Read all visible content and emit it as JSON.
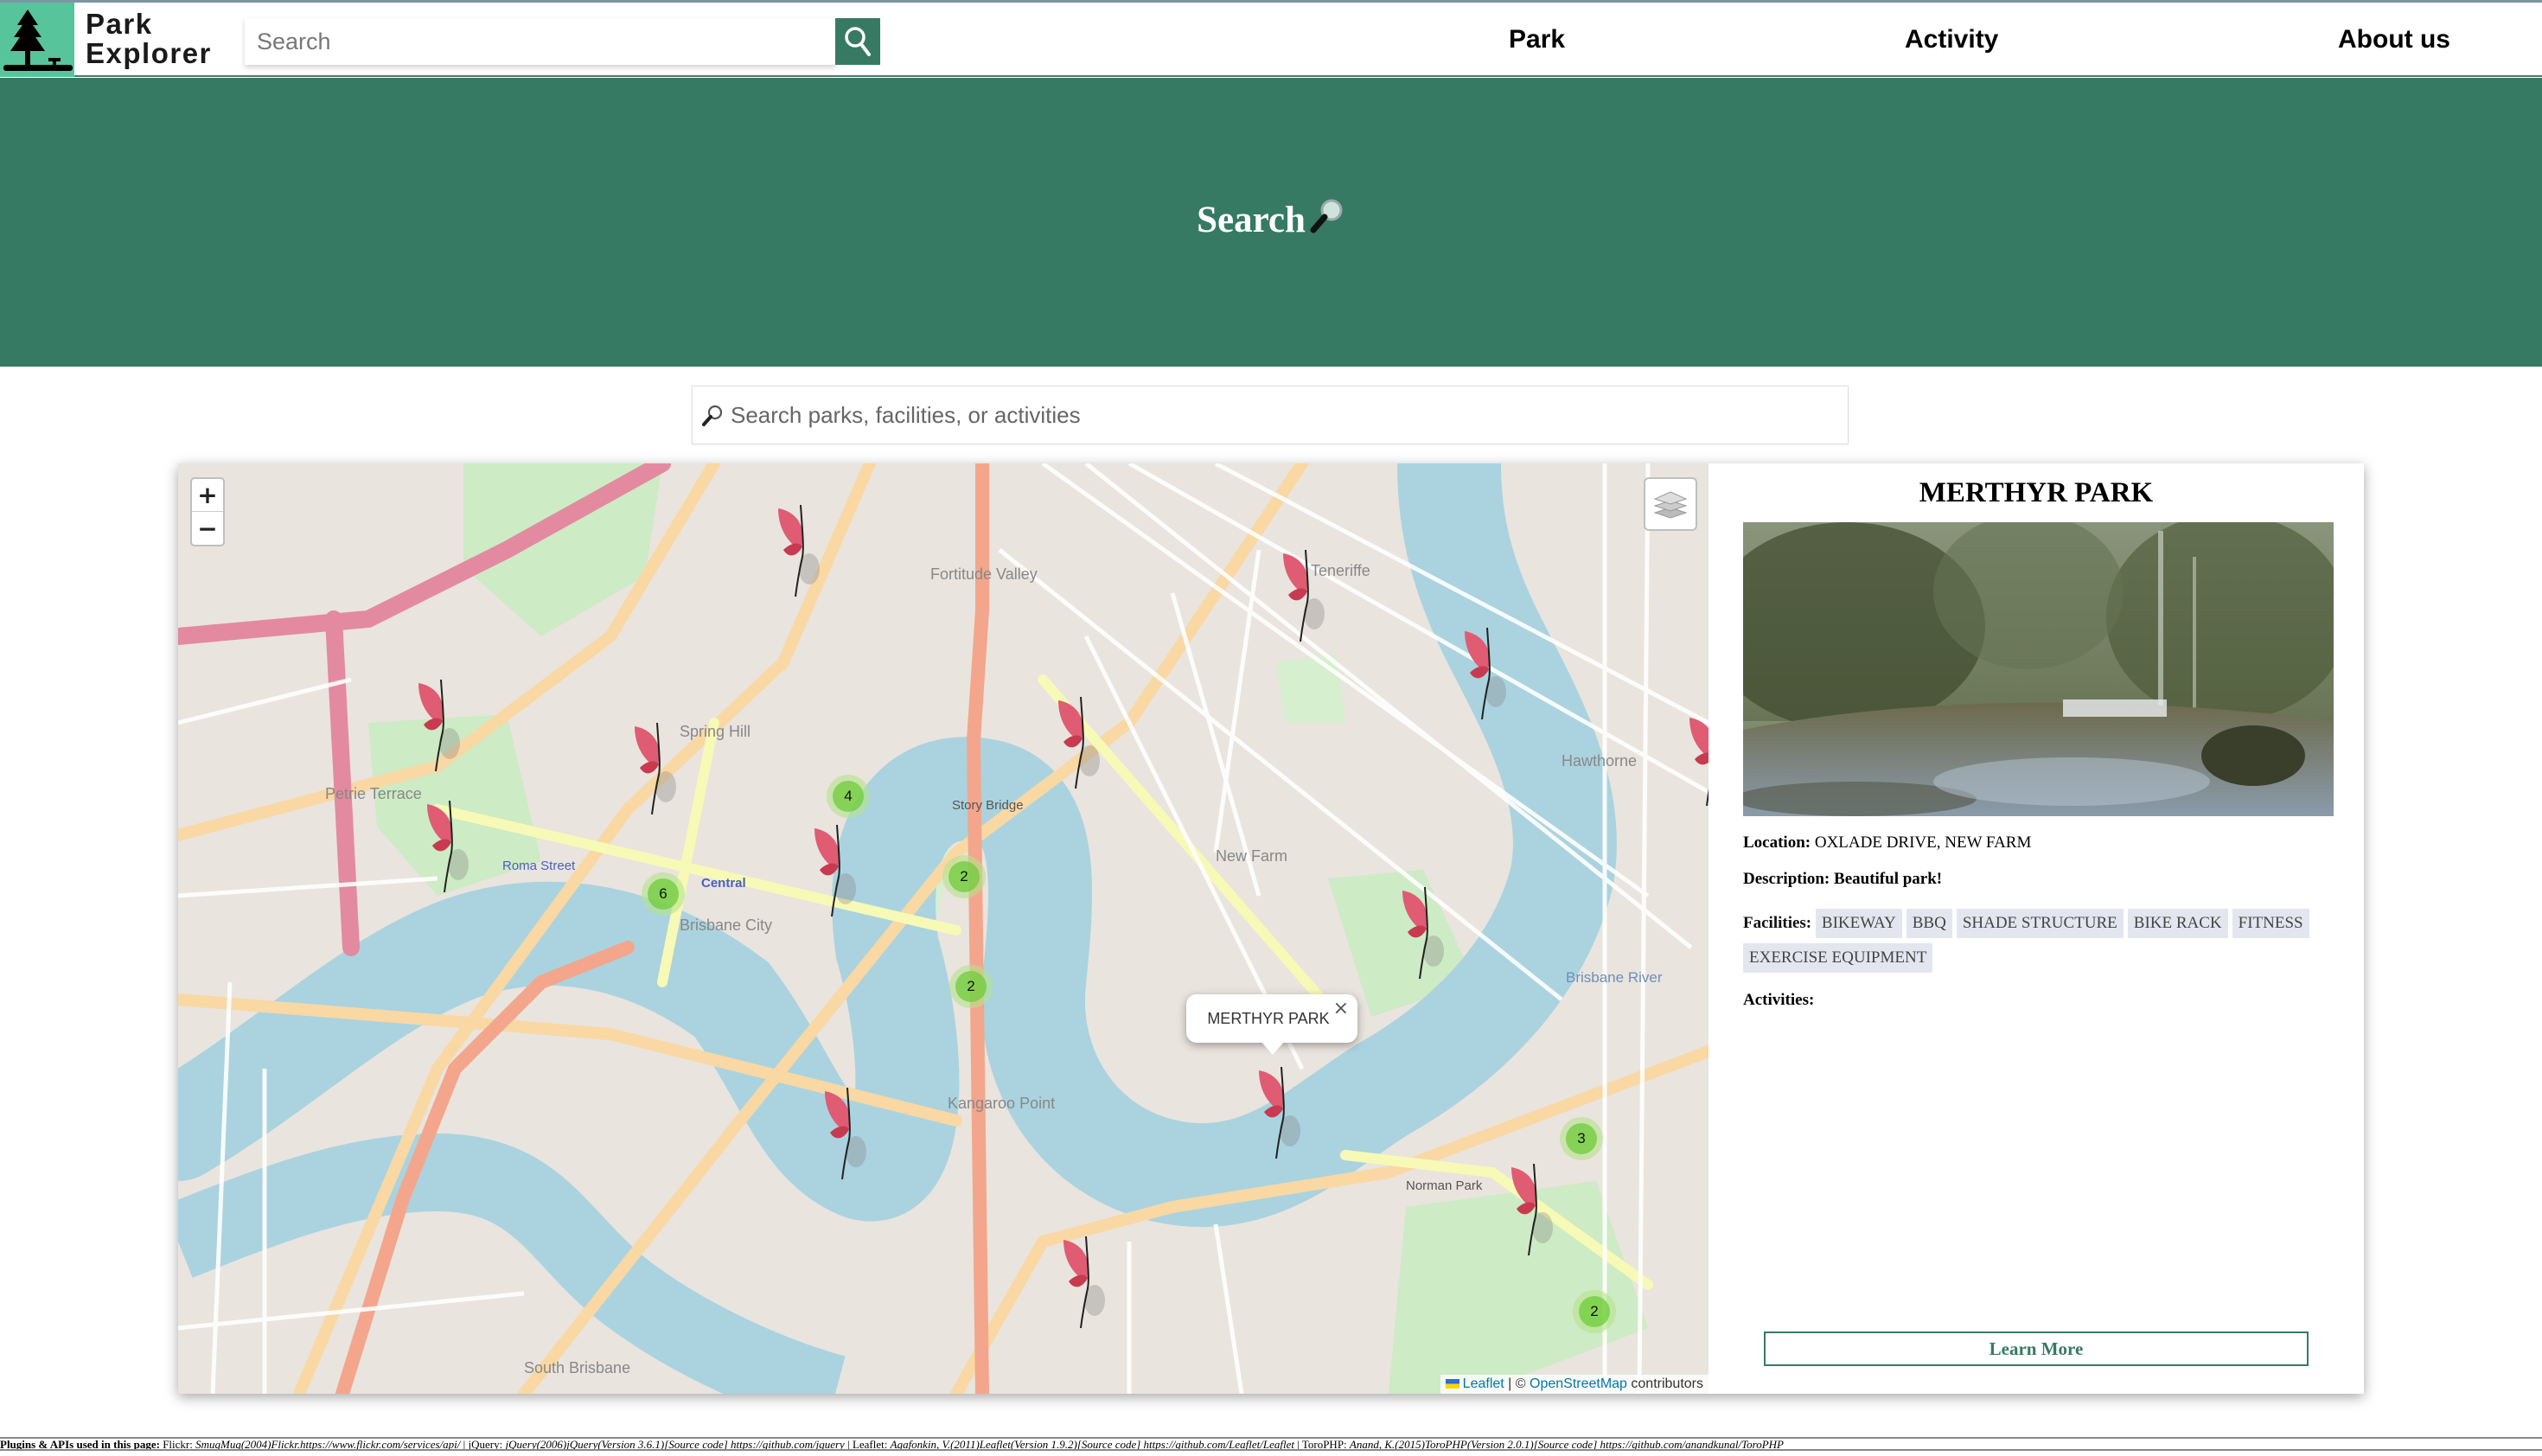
{
  "header": {
    "brand_line1": "Park",
    "brand_line2": "Explorer",
    "search_placeholder": "Search",
    "nav": [
      {
        "label": "Park"
      },
      {
        "label": "Activity"
      },
      {
        "label": "About us"
      }
    ],
    "colors": {
      "logo_bg": "#57c49c",
      "accent": "#377a63"
    }
  },
  "hero": {
    "title": "Search",
    "icon": "magnifying-glass-emoji"
  },
  "main_search": {
    "placeholder": "Search parks, facilities, or activities",
    "value": ""
  },
  "map": {
    "zoom_in_label": "+",
    "zoom_out_label": "−",
    "layers_icon": "layers-icon",
    "area_labels": [
      "Fortitude Valley",
      "Spring Hill",
      "Brisbane City",
      "New Farm",
      "Kangaroo Point",
      "South Brisbane",
      "Petrie Terrace",
      "Teneriffe",
      "Hawthorne",
      "Story Bridge",
      "Brisbane River",
      "Central",
      "Roma Street",
      "Norman Park"
    ],
    "clusters": [
      {
        "count": "4"
      },
      {
        "count": "6"
      },
      {
        "count": "2"
      },
      {
        "count": "2"
      },
      {
        "count": "3"
      },
      {
        "count": "2"
      }
    ],
    "popup": {
      "text": "MERTHYR PARK",
      "close": "×"
    },
    "attribution": {
      "leaflet": "Leaflet",
      "separator": " | © ",
      "osm": "OpenStreetMap",
      "suffix": " contributors"
    }
  },
  "panel": {
    "title": "MERTHYR PARK",
    "location_label": "Location:",
    "location_value": "OXLADE DRIVE, NEW FARM",
    "description_label": "Description:",
    "description_value": "Beautiful park!",
    "facilities_label": "Facilities:",
    "facilities": [
      "BIKEWAY",
      "BBQ",
      "SHADE STRUCTURE",
      "BIKE RACK",
      "FITNESS",
      "EXERCISE EQUIPMENT"
    ],
    "activities_label": "Activities:",
    "activities": [],
    "learn_more": "Learn More"
  },
  "footer": {
    "label": "Plugins & APIs used in this page:",
    "items": [
      {
        "name": "Flickr:",
        "citation": "SmugMug(2004)Flickr.https://www.flickr.com/services/api/"
      },
      {
        "name": "jQuery:",
        "citation": "jQuery(2006)jQuery(Version 3.6.1)[Source code] https://github.com/jquery"
      },
      {
        "name": "Leaflet:",
        "citation": "Agafonkin, V.(2011)Leaflet(Version 1.9.2)[Source code] https://github.com/Leaflet/Leaflet"
      },
      {
        "name": "ToroPHP:",
        "citation": "Anand, K.(2015)ToroPHP(Version 2.0.1)[Source code] https://github.com/anandkunal/ToroPHP"
      }
    ]
  }
}
